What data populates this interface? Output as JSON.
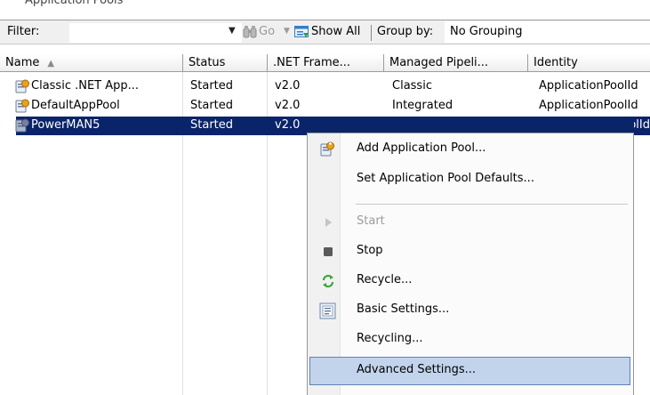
{
  "header_fragment": "Application Pools",
  "filter_bar": {
    "filter_label": "Filter:",
    "go_label": "Go",
    "show_all_label": "Show All",
    "group_by_label": "Group by:",
    "group_by_value": "No Grouping"
  },
  "grid": {
    "columns": [
      "Name",
      ".NET Frame...",
      "Managed Pipeli...",
      "Identity",
      "Status"
    ],
    "rows": [
      {
        "name": "Classic .NET App...",
        "status": "Started",
        "framework": "v2.0",
        "pipeline": "Classic",
        "identity": "ApplicationPoolId"
      },
      {
        "name": "DefaultAppPool",
        "status": "Started",
        "framework": "v2.0",
        "pipeline": "Integrated",
        "identity": "ApplicationPoolId"
      },
      {
        "name": "PowerMAN5",
        "status": "Started",
        "framework": "v2.0",
        "pipeline": "",
        "identity": "ApplicationPoolId"
      }
    ]
  },
  "context_menu": {
    "items": [
      {
        "label": "Add Application Pool...",
        "icon": "add-pool-icon",
        "enabled": true
      },
      {
        "label": "Set Application Pool Defaults...",
        "icon": "",
        "enabled": true
      },
      {
        "label": "Start",
        "icon": "start-icon",
        "enabled": false
      },
      {
        "label": "Stop",
        "icon": "stop-icon",
        "enabled": true
      },
      {
        "label": "Recycle...",
        "icon": "recycle-icon",
        "enabled": true
      },
      {
        "label": "Basic Settings...",
        "icon": "basic-settings-icon",
        "enabled": true
      },
      {
        "label": "Recycling...",
        "icon": "",
        "enabled": true
      },
      {
        "label": "Advanced Settings...",
        "icon": "",
        "enabled": true,
        "highlighted": true
      }
    ]
  },
  "colors": {
    "selection": "#0a246a",
    "menu_hover": "#c2d4ec",
    "menu_hover_border": "#5f82b6"
  }
}
